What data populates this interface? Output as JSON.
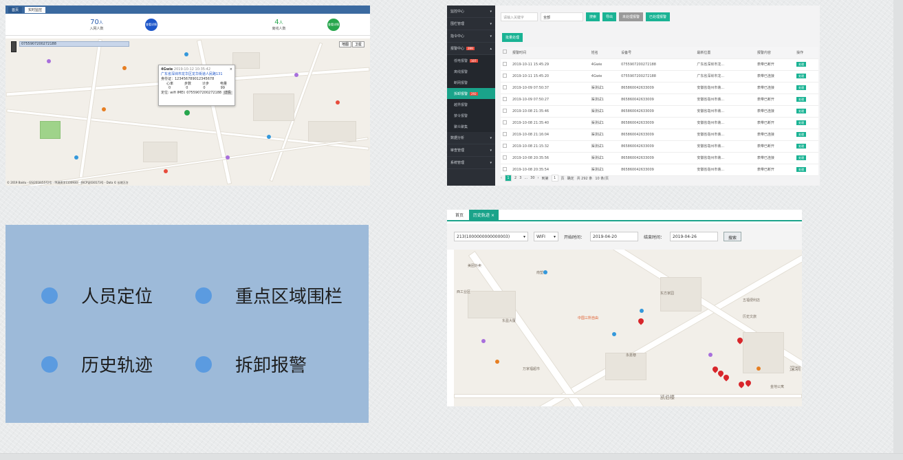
{
  "panel1": {
    "tabs": [
      "首页",
      "实时监控"
    ],
    "stats": [
      {
        "value": "70",
        "unit": "人",
        "label": "入网人数",
        "badge": "查看详情"
      },
      {
        "value": "4",
        "unit": "人",
        "label": "离线人数",
        "badge": "查看详情"
      }
    ],
    "popup": {
      "name": "4Gwie",
      "time": "2019-10-12 10:35:42",
      "address": "广东省深圳市龙华区龙华街道人民路131",
      "id": "身份证：123456789012345678",
      "stat_labels": [
        "心率",
        "步数",
        "计步",
        "电量"
      ],
      "stat_values": [
        "0",
        "0",
        "0",
        "99"
      ],
      "mode": "定位: wifi",
      "imei": "IMEI: 0755907200272188",
      "more_label": "详情"
    },
    "device_tag": "0755907200272188",
    "footer": "© 2019 Baidu - GS(2018)5572号 - 甲测资字1100930 - 京ICP证030173号 - Data © 长地万方",
    "map_type": [
      "地图",
      "卫星"
    ]
  },
  "panel2": {
    "menu": [
      {
        "label": "监控中心"
      },
      {
        "label": "围栏管理"
      },
      {
        "label": "指令中心"
      },
      {
        "label": "报警中心",
        "count": "399"
      },
      {
        "label": "数据分析"
      },
      {
        "label": "审查管理"
      },
      {
        "label": "系统管理"
      }
    ],
    "submenu": [
      {
        "label": "低电报警",
        "count": "107"
      },
      {
        "label": "离线报警"
      },
      {
        "label": "断网报警"
      },
      {
        "label": "拆卸报警",
        "count": "292",
        "active": true
      },
      {
        "label": "越界报警"
      },
      {
        "label": "禁令报警"
      },
      {
        "label": "聚众聚集"
      }
    ],
    "search_placeholder": "请输入关键字",
    "select_value": "全部",
    "buttons": [
      "搜索",
      "导出",
      "未处理报警",
      "已处理报警"
    ],
    "batch_label": "批量处理",
    "headers": [
      "报警时间",
      "姓名",
      "设备号",
      "最新位置",
      "报警内容",
      "操作"
    ],
    "rows": [
      [
        "2019-10-11 15:45:29",
        "4Gwie",
        "0755907200272188",
        "广东省深圳市龙...",
        "表带已断开",
        "处理"
      ],
      [
        "2019-10-11 15:45:20",
        "4Gwie",
        "0755907200272188",
        "广东省深圳市龙...",
        "表带已连接",
        "处理"
      ],
      [
        "2019-10-09 07:50:37",
        "渠测试1",
        "865860042633009",
        "安徽省亳州市谯...",
        "表带已连接",
        "处理"
      ],
      [
        "2019-10-09 07:50:27",
        "渠测试1",
        "865860042633009",
        "安徽省亳州市谯...",
        "表带已断开",
        "处理"
      ],
      [
        "2019-10-08 21:35:46",
        "渠测试1",
        "865860042633009",
        "安徽省亳州市谯...",
        "表带已连接",
        "处理"
      ],
      [
        "2019-10-08 21:35:40",
        "渠测试1",
        "865860042633009",
        "安徽省亳州市谯...",
        "表带已断开",
        "处理"
      ],
      [
        "2019-10-08 21:16:04",
        "渠测试1",
        "865860042633009",
        "安徽省亳州市谯...",
        "表带已连接",
        "处理"
      ],
      [
        "2019-10-08 21:15:32",
        "渠测试1",
        "865860042633009",
        "安徽省亳州市谯...",
        "表带已断开",
        "处理"
      ],
      [
        "2019-10-08 20:35:56",
        "渠测试1",
        "865860042633009",
        "安徽省亳州市谯...",
        "表带已连接",
        "处理"
      ],
      [
        "2019-10-08 20:35:54",
        "渠测试1",
        "865860042633009",
        "安徽省亳州市谯...",
        "表带已断开",
        "处理"
      ]
    ],
    "pager": {
      "pages": [
        "1",
        "2",
        "3",
        "...",
        "30"
      ],
      "goto": "到第",
      "page_input": "1",
      "page_unit": "页",
      "confirm": "确定",
      "total": "共 292 条",
      "per_page": "10 条/页"
    }
  },
  "features": [
    "人员定位",
    "重点区域围栏",
    "历史轨迹",
    "拆卸报警"
  ],
  "panel4": {
    "tabs": [
      "首页",
      "历史轨迹"
    ],
    "device": "213(1000000000000003)",
    "mode": "WIFI",
    "start_label": "开始时间：",
    "start_value": "2019-04-20",
    "end_label": "结束时间：",
    "end_value": "2019-04-26",
    "search": "搜索",
    "places": [
      "美团外卖",
      "南塑通",
      "西工业区",
      "中国三所自由",
      "东盈大厦",
      "万家福超市",
      "历史文旅",
      "深圳",
      "凯伯楼",
      "五福便利店",
      "永嘉巷",
      "东方家园",
      "金地公寓"
    ]
  },
  "colors": {
    "teal": "#1ab394",
    "blue_panel": "#9dbad9",
    "dot": "#5b9be0",
    "sidebar": "#2b2f36"
  }
}
